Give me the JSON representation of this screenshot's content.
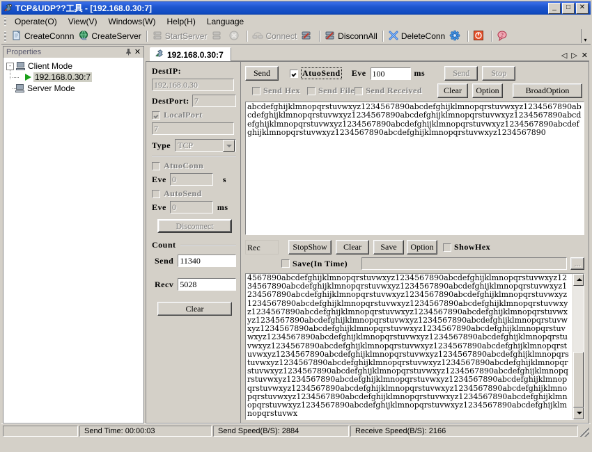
{
  "window": {
    "title": "TCP&UDP??工具 - [192.168.0.30:7]",
    "icon": "network-tool-icon",
    "minimize": "_",
    "maximize": "□",
    "close": "✕"
  },
  "menu": [
    {
      "label": "Operate(O)",
      "name": "menu-operate"
    },
    {
      "label": "View(V)",
      "name": "menu-view"
    },
    {
      "label": "Windows(W)",
      "name": "menu-windows"
    },
    {
      "label": "Help(H)",
      "name": "menu-help"
    },
    {
      "label": "Language",
      "name": "menu-language"
    }
  ],
  "toolbar": {
    "items": [
      {
        "label": "CreateConnn",
        "icon": "new-document-icon",
        "disabled": false
      },
      {
        "label": "CreateServer",
        "icon": "globe-icon",
        "disabled": false
      },
      {
        "label": "StartServer",
        "icon": "server-start-icon",
        "disabled": true
      },
      {
        "label": "",
        "icon": "server-stop-icon",
        "disabled": true
      },
      {
        "label": "",
        "icon": "cancel-circle-icon",
        "disabled": true
      },
      {
        "label": "Connect",
        "icon": "connect-icon",
        "disabled": true
      },
      {
        "label": "",
        "icon": "disconnect-single-icon",
        "disabled": false
      },
      {
        "label": "DisconnAll",
        "icon": "disconnect-all-icon",
        "disabled": false
      },
      {
        "label": "DeleteConn",
        "icon": "delete-x-icon",
        "disabled": false
      },
      {
        "label": "",
        "icon": "gear-blue-icon",
        "disabled": false
      },
      {
        "label": "",
        "icon": "power-icon",
        "disabled": false
      },
      {
        "label": "",
        "icon": "help-balloon-icon",
        "disabled": false
      }
    ],
    "overflow": "chevron-down-icon"
  },
  "properties": {
    "title": "Properties",
    "pin": "pin-icon",
    "close": "✕",
    "tree": [
      {
        "label": "Client Mode",
        "icon": "computer-icon",
        "expander": "-",
        "selected": false
      },
      {
        "label": "192.168.0.30:7",
        "icon": "play-icon",
        "selected": true
      },
      {
        "label": "Server Mode",
        "icon": "computer-icon",
        "selected": false
      }
    ]
  },
  "tabs": {
    "active": "192.168.0.30:7",
    "icon": "connection-icon",
    "nav": {
      "prev": "◁",
      "next": "▷",
      "close": "✕"
    }
  },
  "config": {
    "destip_label": "DestIP:",
    "destip_value": "192.168.0.30",
    "destport_label": "DestPort:",
    "destport_value": "7",
    "localport_label": "LocalPort",
    "localport_checked": true,
    "localport_value": "7",
    "type_label": "Type",
    "type_value": "TCP",
    "autoconn_label": "AtuoConn",
    "autoconn_checked": false,
    "autoconn_eve_label": "Eve",
    "autoconn_eve_value": "0",
    "autoconn_unit": "s",
    "autosend_label": "AutoSend",
    "autosend_checked": false,
    "autosend_eve_label": "Eve",
    "autosend_eve_value": "0",
    "autosend_unit": "ms",
    "disconnect_label": "Disconnect",
    "count_label": "Count",
    "send_label": "Send",
    "send_value": "11340",
    "recv_label": "Recv",
    "recv_value": "5028",
    "clear_label": "Clear"
  },
  "send_panel": {
    "send_button": "Send",
    "autosend_label": "AtuoSend",
    "autosend_checked": true,
    "eve_label": "Eve",
    "eve_value": "100",
    "eve_unit": "ms",
    "send_hex_label": "Send Hex",
    "send_hex_checked": false,
    "send_file_label": "Send File",
    "send_file_checked": false,
    "send_received_label": "Send Received",
    "send_received_checked": false,
    "right_send": "Send",
    "right_stop": "Stop",
    "right_clear": "Clear",
    "right_option": "Option",
    "broadoption": "BroadOption",
    "text": "abcdefghijklmnopqrstuvwxyz1234567890abcdefghijklmnopqrstuvwxyz1234567890abcdefghijklmnopqrstuvwxyz1234567890abcdefghijklmnopqrstuvwxyz1234567890abcdefghijklmnopqrstuvwxyz1234567890abcdefghijklmnopqrstuvwxyz1234567890abcdefghijklmnopqrstuvwxyz1234567890abcdefghijklmnopqrstuvwxyz1234567890"
  },
  "recv_panel": {
    "rec_label": "Rec",
    "stopshow_label": "StopShow",
    "clear_label": "Clear",
    "save_label": "Save",
    "option_label": "Option",
    "showhex_label": "ShowHex",
    "showhex_checked": false,
    "save_in_time_label": "Save(In Time)",
    "save_in_time_checked": false,
    "save_path_value": "",
    "browse_label": "...",
    "text": "4567890abcdefghijklmnopqrstuvwxyz1234567890abcdefghijklmnopqrstuvwxyz1234567890abcdefghijklmnopqrstuvwxyz1234567890abcdefghijklmnopqrstuvwxyz1234567890abcdefghijklmnopqrstuvwxyz1234567890abcdefghijklmnopqrstuvwxyz1234567890abcdefghijklmnopqrstuvwxyz1234567890abcdefghijklmnopqrstuvwxyz1234567890abcdefghijklmnopqrstuvwxyz1234567890abcdefghijklmnopqrstuvwxyz1234567890abcdefghijklmnopqrstuvwxyz1234567890abcdefghijklmnopqrstuvwxyz1234567890abcdefghijklmnopqrstuvwxyz1234567890abcdefghijklmnopqrstuvwxyz1234567890abcdefghijklmnopqrstuvwxyz1234567890abcdefghijklmnopqrstuvwxyz1234567890abcdefghijklmnopqrstuvwxyz1234567890abcdefghijklmnopqrstuvwxyz1234567890abcdefghijklmnopqrstuvwxyz1234567890abcdefghijklmnopqrstuvwxyz1234567890abcdefghijklmnopqrstuvwxyz1234567890abcdefghijklmnopqrstuvwxyz1234567890abcdefghijklmnopqrstuvwxyz1234567890abcdefghijklmnopqrstuvwxyz1234567890abcdefghijklmnopqrstuvwxyz1234567890abcdefghijklmnopqrstuvwxyz1234567890abcdefghijklmnopqrstuvwxyz1234567890abcdefghijklmnopqrstuvwxyz1234567890abcdefghijklmnopqrstuvwxyz1234567890abcdefghijklmnopqrstuvwxyz1234567890abcdefghijklmnopqrstuvwxyz1234567890abcdefghijklmnopqrstuvwx"
  },
  "status": {
    "send_time": "Send Time: 00:00:03",
    "send_speed": "Send Speed(B/S): 2884",
    "receive_speed": "Receive Speed(B/S): 2166"
  },
  "colors": {
    "face": "#d4d0c8",
    "title_blue": "#0a3da5",
    "selection": "#cfcfc4",
    "disabled_text": "#808080"
  }
}
